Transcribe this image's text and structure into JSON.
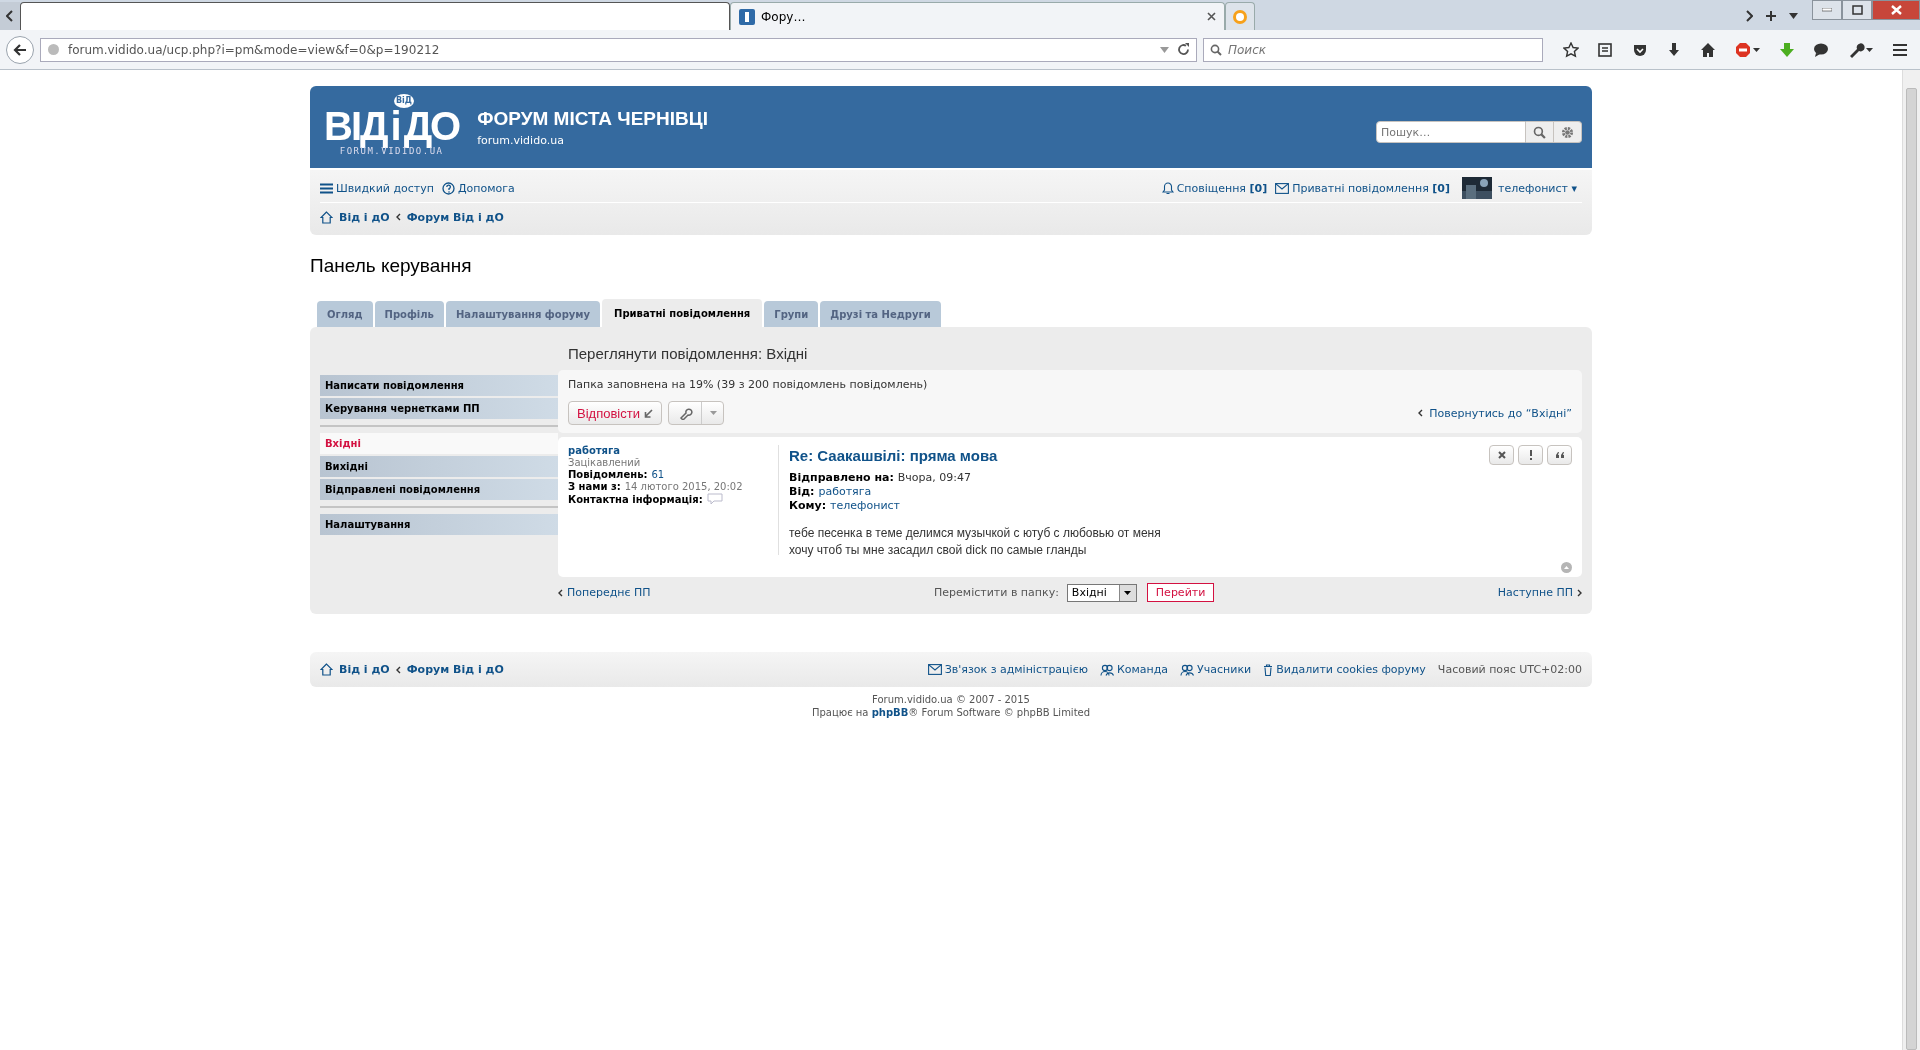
{
  "browser": {
    "tabs": [
      {
        "kind": "blank",
        "selected": false
      },
      {
        "kind": "page",
        "label": "Фору…",
        "selected": true
      },
      {
        "kind": "icon",
        "selected": false
      }
    ],
    "url": "forum.vidido.ua/ucp.php?i=pm&mode=view&f=0&p=190212",
    "search_placeholder": "Поиск"
  },
  "header": {
    "logo": [
      "ВІД",
      "і",
      "ДО"
    ],
    "logo_badge": "ВіД",
    "logo_caption": "FORUM.VIDIDO.UA",
    "title": "ФОРУМ МІСТА ЧЕРНІВЦІ",
    "subtitle": "forum.vidido.ua",
    "search_placeholder": "Пошук…"
  },
  "navbar": {
    "quick_access": "Швидкий доступ",
    "help": "Допомога",
    "notifications": "Сповіщення **[0]**",
    "messages": "Приватні повідомлення **[0]**",
    "user": "телефонист ▾"
  },
  "breadcrumbs": [
    "Від і дО",
    "Форум Від і дО"
  ],
  "page_title": "Панель керування",
  "tabs": [
    {
      "label": "Огляд",
      "selected": false
    },
    {
      "label": "Профіль",
      "selected": false
    },
    {
      "label": "Налаштування форуму",
      "selected": false
    },
    {
      "label": "Приватні повідомлення",
      "selected": true
    },
    {
      "label": "Групи",
      "selected": false
    },
    {
      "label": "Друзі та Недруги",
      "selected": false
    }
  ],
  "sidebar": [
    [
      {
        "label": "Написати повідомлення",
        "selected": false
      },
      {
        "label": "Керування чернетками ПП",
        "selected": false
      }
    ],
    [
      {
        "label": "Вхідні",
        "selected": true
      },
      {
        "label": "Вихідні",
        "selected": false
      },
      {
        "label": "Відправлені повідомлення",
        "selected": false
      }
    ],
    [
      {
        "label": "Налаштування",
        "selected": false
      }
    ]
  ],
  "content": {
    "heading": "Переглянути повідомлення: Вхідні",
    "folder_status": "Папка заповнена на 19% (39 з 200 повідомлень повідомлень)",
    "reply_button": "Відповісти",
    "back_link": "Повернутись до “Вхідні”",
    "post": {
      "author": "работяга",
      "rank": "Зацікавлений",
      "profile": [
        {
          "label": "Повідомлень:",
          "value": "61"
        },
        {
          "label": "З нами з:",
          "value": "14 лютого 2015, 20:02"
        }
      ],
      "contact_label": "Контактна інформація:",
      "title": "Re: Саакашвілі: пряма мова",
      "meta": [
        {
          "label": "Відправлено на:",
          "value": "Вчора, 09:47",
          "kind": "text"
        },
        {
          "label": "Від:",
          "value": "работяга",
          "kind": "link"
        },
        {
          "label": "Кому:",
          "value": "телефонист",
          "kind": "link"
        }
      ],
      "body": [
        "тебе песенка в теме делимся музычкой с ютуб с любовью от меня",
        "хочу чтоб ты мне засадил свой dick по самые гланды"
      ]
    },
    "prev_link": "Попереднє ПП",
    "move_label": "Перемістити в папку:",
    "move_select": "Вхідні",
    "go_button": "Перейти",
    "next_link": "Наступне ПП"
  },
  "footer": {
    "breadcrumbs": [
      "Від і дО",
      "Форум Від і дО"
    ],
    "links": [
      "Зв'язок з адміністрацією",
      "Команда",
      "Учасники",
      "Видалити cookies форуму"
    ],
    "timezone": "Часовий пояс UTC+02:00",
    "copyright": "Forum.vidido.ua © 2007 - 2015",
    "powered": "Працює на **phpBB**® Forum Software © phpBB Limited"
  }
}
